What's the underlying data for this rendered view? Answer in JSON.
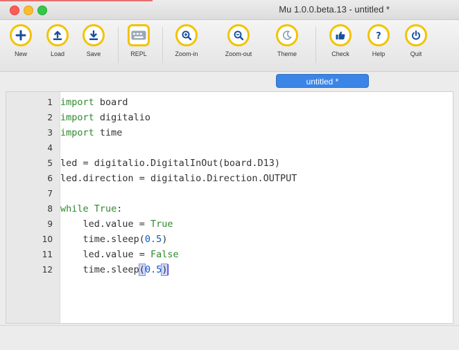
{
  "window": {
    "title": "Mu 1.0.0.beta.13 - untitled *"
  },
  "toolbar": {
    "buttons": [
      {
        "label": "New",
        "icon": "plus-icon"
      },
      {
        "label": "Load",
        "icon": "upload-icon"
      },
      {
        "label": "Save",
        "icon": "download-icon"
      },
      {
        "label": "REPL",
        "icon": "keyboard-icon"
      },
      {
        "label": "Zoom-in",
        "icon": "zoom-in-icon"
      },
      {
        "label": "Zoom-out",
        "icon": "zoom-out-icon"
      },
      {
        "label": "Theme",
        "icon": "moon-icon"
      },
      {
        "label": "Check",
        "icon": "thumbs-up-icon"
      },
      {
        "label": "Help",
        "icon": "question-icon"
      },
      {
        "label": "Quit",
        "icon": "power-icon"
      }
    ]
  },
  "tabs": [
    {
      "label": "untitled *",
      "active": true
    }
  ],
  "editor": {
    "line_numbers": [
      "1",
      "2",
      "3",
      "4",
      "5",
      "6",
      "7",
      "8",
      "9",
      "10",
      "11",
      "12"
    ],
    "lines": [
      "import board",
      "import digitalio",
      "import time",
      "",
      "led = digitalio.DigitalInOut(board.D13)",
      "led.direction = digitalio.Direction.OUTPUT",
      "",
      "while True:",
      "    led.value = True",
      "    time.sleep(0.5)",
      "    led.value = False",
      "    time.sleep(0.5)"
    ]
  },
  "colors": {
    "accent": "#f2c300",
    "tab": "#3b85e6",
    "keyword": "#2d8a2d",
    "number": "#0a56c9"
  }
}
